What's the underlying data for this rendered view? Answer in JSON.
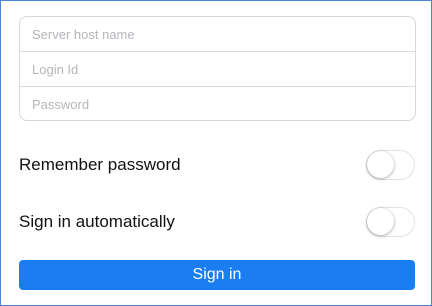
{
  "form": {
    "server_host": {
      "value": "",
      "placeholder": "Server host name"
    },
    "login_id": {
      "value": "",
      "placeholder": "Login Id"
    },
    "password": {
      "value": "",
      "placeholder": "Password"
    }
  },
  "options": {
    "remember_password": {
      "label": "Remember password",
      "on": false
    },
    "sign_in_automatically": {
      "label": "Sign in automatically",
      "on": false
    }
  },
  "actions": {
    "sign_in_label": "Sign in"
  },
  "colors": {
    "accent": "#1a7ef2",
    "frame_border": "#4a88d6",
    "field_border": "#d7d7dc",
    "placeholder": "#b5b5bb"
  }
}
